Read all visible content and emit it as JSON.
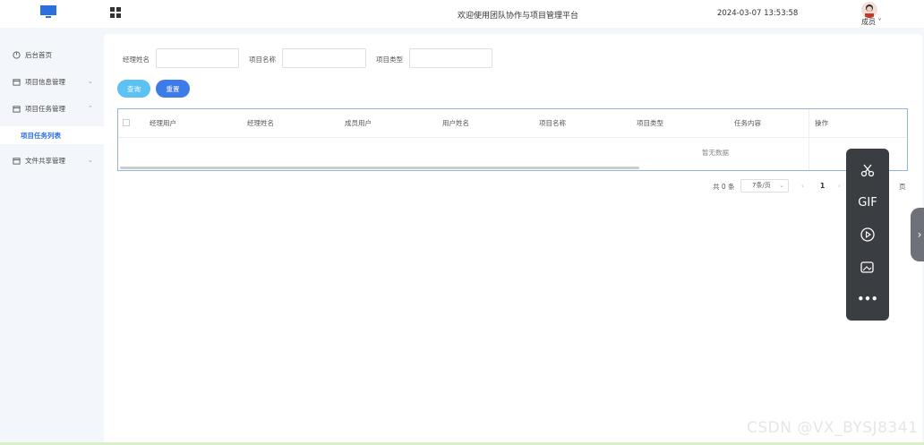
{
  "header": {
    "title": "欢迎使用团队协作与项目管理平台",
    "datetime": "2024-03-07 13:53:58",
    "user": "成员"
  },
  "sidebar": {
    "items": [
      {
        "label": "后台首页",
        "icon": "dashboard-icon"
      },
      {
        "label": "项目信息管理",
        "icon": "folder-icon",
        "chevron": "⌄"
      },
      {
        "label": "项目任务管理",
        "icon": "task-icon",
        "chevron": "⌃",
        "expanded": true
      },
      {
        "label": "文件共享管理",
        "icon": "file-icon",
        "chevron": "⌄"
      }
    ],
    "sub_items": [
      {
        "label": "项目任务列表",
        "active": true
      }
    ]
  },
  "filters": {
    "manager_name": {
      "label": "经理姓名",
      "value": "",
      "placeholder": ""
    },
    "project_name": {
      "label": "项目名称",
      "value": "",
      "placeholder": ""
    },
    "project_type": {
      "label": "项目类型",
      "value": "",
      "placeholder": ""
    },
    "query_button": "查询",
    "reset_button": "重置"
  },
  "table": {
    "columns": [
      "经理用户",
      "经理姓名",
      "成员用户",
      "用户姓名",
      "项目名称",
      "项目类型",
      "任务内容",
      "操作"
    ],
    "rows": [],
    "empty_text": "暂无数据"
  },
  "pagination": {
    "total_text": "共 0 条",
    "page_size": "7条/页",
    "prev": "‹",
    "current_page": "1",
    "next": "›",
    "goto_suffix": "页"
  },
  "float_toolbar": {
    "items": [
      "scissors-icon",
      "gif-icon",
      "record-icon",
      "image-icon",
      "more-icon"
    ],
    "gif_label": "GIF",
    "more_label": "•••"
  },
  "side_tab": {
    "label": "›"
  },
  "watermark": "CSDN @VX_BYSJ8341",
  "colors": {
    "primary": "#3c7be8",
    "query_button": "#5bc2f2",
    "active_nav": "#2c70e0",
    "table_border": "#8fb4e6"
  }
}
